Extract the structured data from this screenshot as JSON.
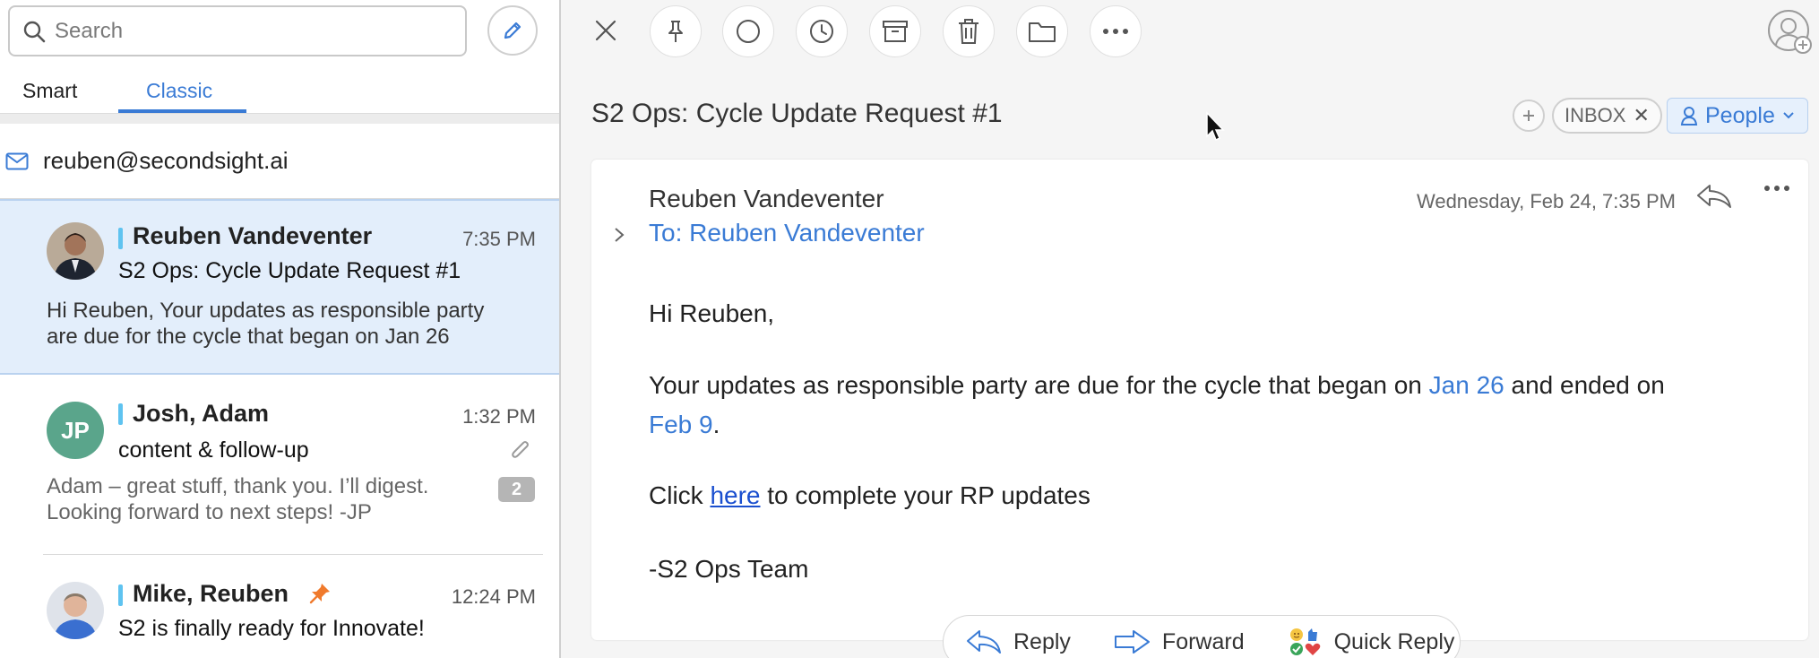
{
  "search": {
    "placeholder": "Search"
  },
  "tabs": [
    {
      "label": "Smart"
    },
    {
      "label": "Classic"
    }
  ],
  "account": {
    "email": "reuben@secondsight.ai"
  },
  "messages": [
    {
      "sender": "Reuben Vandeventer",
      "time": "7:35 PM",
      "subject": "S2 Ops: Cycle Update Request #1",
      "preview_line1": "Hi Reuben, Your updates as responsible party",
      "preview_line2": "are due for the cycle that began on Jan 26"
    },
    {
      "initials": "JP",
      "sender": "Josh, Adam",
      "time": "1:32 PM",
      "subject": "content & follow-up",
      "preview_line1": "Adam – great stuff, thank you. I’ll digest.",
      "preview_line2": "Looking forward to next steps! -JP",
      "count": "2"
    },
    {
      "sender": "Mike, Reuben",
      "time": "12:24 PM",
      "subject": "S2 is finally ready for Innovate!"
    }
  ],
  "thread": {
    "title": "S2 Ops: Cycle Update Request #1",
    "tag": "INBOX",
    "people_label": "People",
    "from": "Reuben Vandeventer",
    "date": "Wednesday, Feb 24, 7:35 PM",
    "to": "To: Reuben Vandeventer",
    "greeting": "Hi Reuben,",
    "para1_a": "Your updates as responsible party are due for the cycle that began on ",
    "para1_date1": "Jan 26",
    "para1_b": " and ended on",
    "para1_date2": "Feb 9",
    "para1_end": ".",
    "para2_a": "Click ",
    "para2_link": "here",
    "para2_b": " to complete your RP updates",
    "signoff": "-S2 Ops Team"
  },
  "actions": {
    "reply": "Reply",
    "forward": "Forward",
    "quick_reply": "Quick Reply"
  },
  "colors": {
    "accent": "#3a7bd5",
    "selected_row": "#e3eefb",
    "unread_bar": "#5fc3f0",
    "pin": "#f07a2c"
  }
}
